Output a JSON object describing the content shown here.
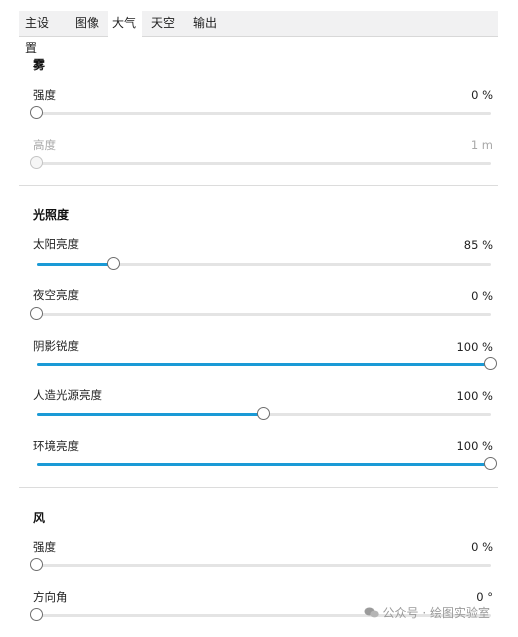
{
  "tabs": [
    {
      "label": "主设置",
      "active": false
    },
    {
      "label": "图像",
      "active": false
    },
    {
      "label": "大气",
      "active": true
    },
    {
      "label": "天空",
      "active": false
    },
    {
      "label": "输出",
      "active": false
    }
  ],
  "fog": {
    "title": "雾",
    "strength": {
      "label": "强度",
      "value_text": "0 %",
      "value": 0,
      "disabled": false
    },
    "height": {
      "label": "高度",
      "value_text": "1 m",
      "value": 0,
      "disabled": true
    }
  },
  "lighting": {
    "title": "光照度",
    "sun": {
      "label": "太阳亮度",
      "value_text": "85 %",
      "fraction": 0.17
    },
    "night_sky": {
      "label": "夜空亮度",
      "value_text": "0 %",
      "fraction": 0.0
    },
    "shadow_sharpness": {
      "label": "阴影锐度",
      "value_text": "100 %",
      "fraction": 1.0
    },
    "artificial_light": {
      "label": "人造光源亮度",
      "value_text": "100 %",
      "fraction": 0.5
    },
    "ambient": {
      "label": "环境亮度",
      "value_text": "100 %",
      "fraction": 1.0
    }
  },
  "wind": {
    "title": "风",
    "strength": {
      "label": "强度",
      "value_text": "0 %",
      "fraction": 0.0
    },
    "direction": {
      "label": "方向角",
      "value_text": "0 °",
      "fraction": 0.0
    }
  },
  "watermark": "公众号 · 绘图实验室",
  "colors": {
    "accent": "#1a9ad6",
    "track": "#e4e4e4"
  }
}
